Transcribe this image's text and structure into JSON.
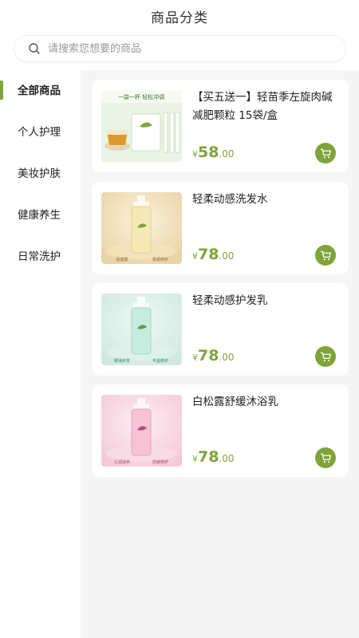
{
  "header": {
    "title": "商品分类"
  },
  "search": {
    "placeholder": "请搜索您想要的商品"
  },
  "sidebar": {
    "items": [
      {
        "label": "全部商品",
        "active": true
      },
      {
        "label": "个人护理",
        "active": false
      },
      {
        "label": "美妆护肤",
        "active": false
      },
      {
        "label": "健康养生",
        "active": false
      },
      {
        "label": "日常洗护",
        "active": false
      }
    ]
  },
  "products": [
    {
      "name": "【买五送一】轻苗季左旋肉碱减肥颗粒 15袋/盒",
      "currency": "¥",
      "price_int": "58",
      "price_dec": ".00",
      "image": {
        "icon": "tea-granules-box-image",
        "banner_text": "一袋一杯 轻松冲调"
      }
    },
    {
      "name": "轻柔动感洗发水",
      "currency": "¥",
      "price_int": "78",
      "price_dec": ".00",
      "image": {
        "icon": "shampoo-bottle-image",
        "tags": [
          "氨基酸",
          "柔顺修护"
        ]
      }
    },
    {
      "name": "轻柔动感护发乳",
      "currency": "¥",
      "price_int": "78",
      "price_dec": ".00",
      "image": {
        "icon": "conditioner-bottle-image",
        "tags": [
          "顺滑护发",
          "丰盈修护"
        ]
      }
    },
    {
      "name": "白松露舒缓沐浴乳",
      "currency": "¥",
      "price_int": "78",
      "price_dec": ".00",
      "image": {
        "icon": "body-wash-bottle-image",
        "tags": [
          "沁润滋养",
          "舒缓修护"
        ]
      }
    }
  ],
  "colors": {
    "accent": "#7fa43a",
    "background": "#f5f5f5",
    "card": "#ffffff"
  }
}
